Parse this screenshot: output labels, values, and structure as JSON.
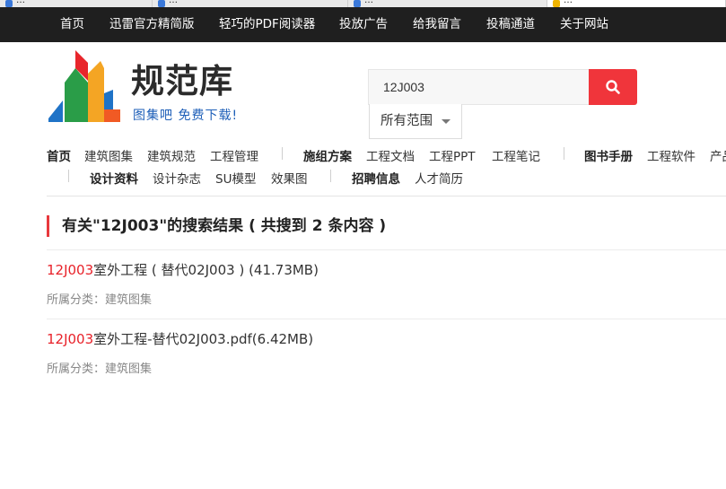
{
  "browser_tabs": [
    {
      "title": "…"
    },
    {
      "title": "…"
    },
    {
      "title": "…"
    },
    {
      "title": "…"
    }
  ],
  "top_nav": [
    {
      "label": "首页"
    },
    {
      "label": "迅雷官方精简版"
    },
    {
      "label": "轻巧的PDF阅读器"
    },
    {
      "label": "投放广告"
    },
    {
      "label": "给我留言"
    },
    {
      "label": "投稿通道"
    },
    {
      "label": "关于网站"
    }
  ],
  "logo": {
    "brand": "规范库",
    "slogan": "图集吧  免费下载!",
    "colors": [
      "#e8262c",
      "#f4a524",
      "#2a9d48",
      "#1f73c7",
      "#f15a24"
    ]
  },
  "search": {
    "value": "12J003",
    "button_icon": "search-icon",
    "button_color": "#f0353b",
    "scope_selected": "所有范围"
  },
  "category_nav": {
    "row1": [
      "首页",
      "建筑图集",
      "建筑规范",
      "工程管理",
      "施组方案",
      "工程文档",
      "工程PPT",
      "工程笔记",
      "图书手册",
      "工程软件",
      "产品"
    ],
    "row2": [
      "设计资料",
      "设计杂志",
      "SU模型",
      "效果图",
      "招聘信息",
      "人才简历"
    ]
  },
  "results": {
    "heading": "有关\"12J003\"的搜索结果 ( 共搜到 2 条内容 )",
    "accent_color": "#e8383d",
    "items": [
      {
        "highlight": "12J003",
        "title_rest": "室外工程 ( 替代02J003 ) (41.73MB)",
        "category": "所属分类：建筑图集"
      },
      {
        "highlight": "12J003",
        "title_rest": "室外工程-替代02J003.pdf(6.42MB)",
        "category": "所属分类：建筑图集"
      }
    ]
  }
}
